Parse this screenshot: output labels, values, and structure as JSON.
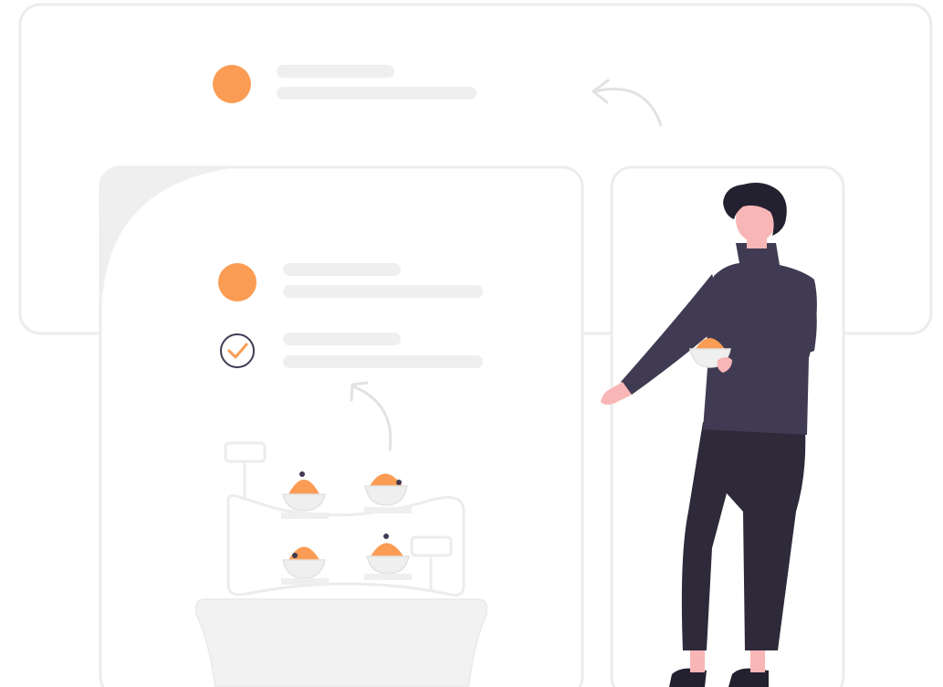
{
  "illustration": {
    "kind": "flat vector illustration",
    "colors": {
      "background": "#ffffff",
      "card_border": "#ececec",
      "placeholder_bar": "#efefef",
      "accent_orange": "#fb9c54",
      "sweater": "#403b52",
      "pants": "#2e2a3a",
      "hair": "#232030",
      "skin": "#f9b6b6",
      "arrow": "#e2e2e2",
      "check_ring": "#403b52"
    }
  }
}
